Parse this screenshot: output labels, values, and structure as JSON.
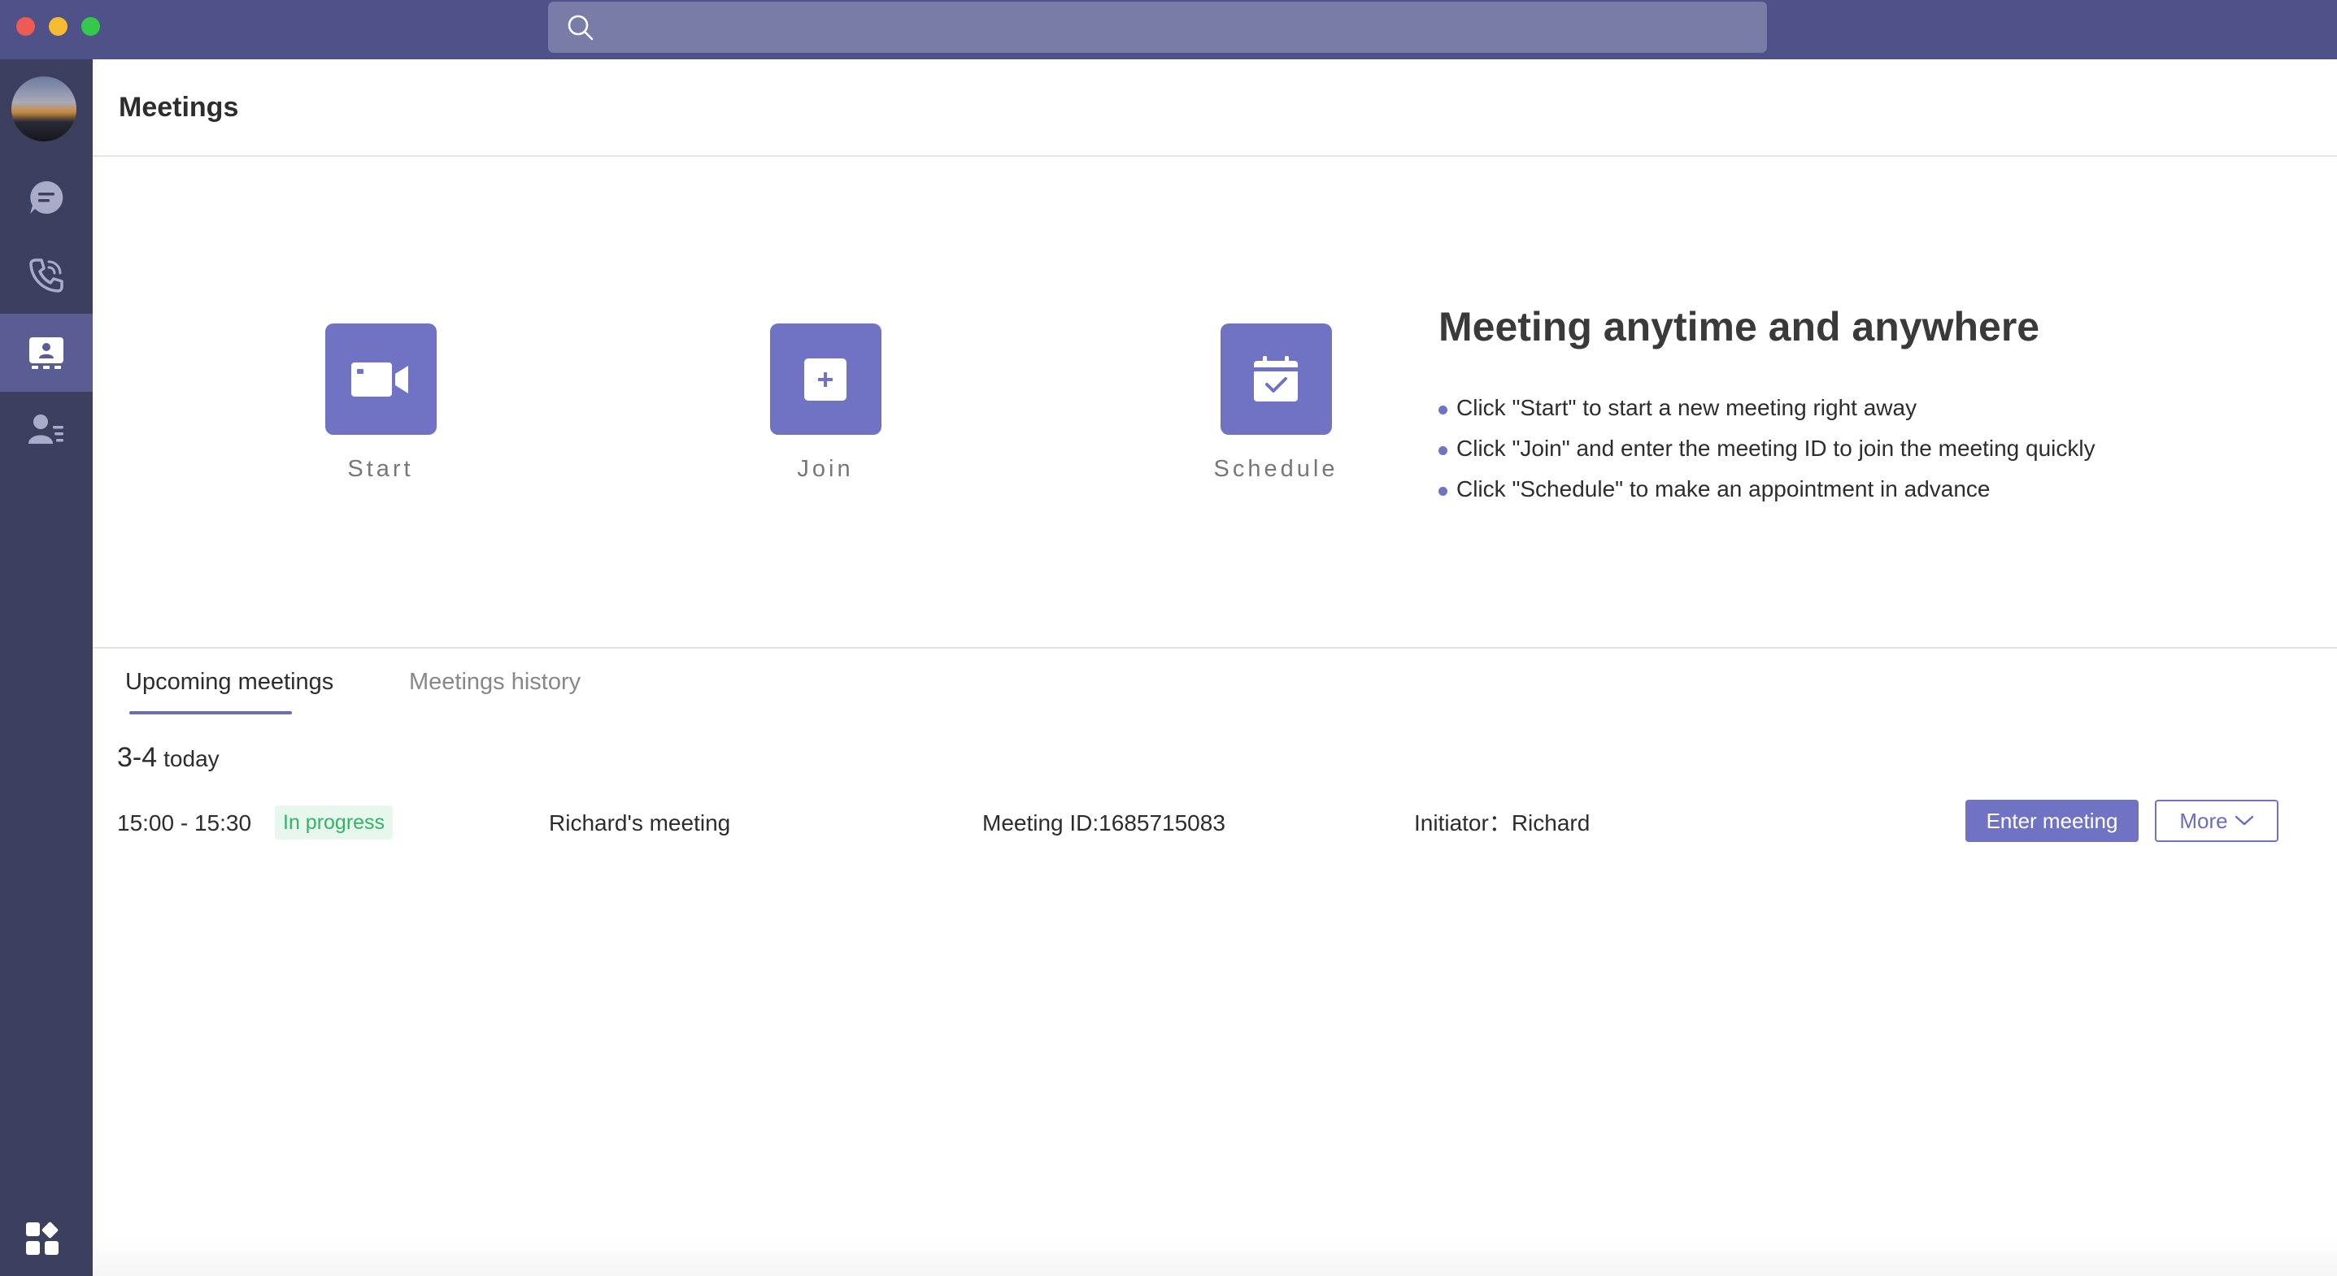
{
  "titlebar": {
    "search_icon": "search-icon",
    "search_placeholder": ""
  },
  "sidebar": {
    "avatar": "avatar",
    "items": [
      {
        "icon": "chat-icon",
        "active": false
      },
      {
        "icon": "phone-icon",
        "active": false
      },
      {
        "icon": "meetings-icon",
        "active": true
      },
      {
        "icon": "contacts-icon",
        "active": false
      }
    ],
    "bottom_icon": "apps-icon"
  },
  "header": {
    "title": "Meetings"
  },
  "actions": [
    {
      "label": "Start",
      "icon": "video-camera-icon"
    },
    {
      "label": "Join",
      "icon": "join-plus-icon"
    },
    {
      "label": "Schedule",
      "icon": "calendar-check-icon"
    }
  ],
  "info": {
    "title": "Meeting anytime and anywhere",
    "bullets": [
      "Click \"Start\" to start a new meeting right away",
      "Click \"Join\" and enter the meeting ID to join the meeting quickly",
      "Click \"Schedule\" to make an appointment in advance"
    ]
  },
  "tabs": [
    {
      "label": "Upcoming meetings",
      "active": true
    },
    {
      "label": "Meetings history",
      "active": false
    }
  ],
  "date_group": {
    "date": "3-4",
    "suffix": "today"
  },
  "meeting": {
    "time": "15:00 - 15:30",
    "status": "In progress",
    "title": "Richard's meeting",
    "meeting_id": "Meeting ID:1685715083",
    "initiator": "Initiator：Richard",
    "enter_label": "Enter meeting",
    "more_label": "More"
  },
  "colors": {
    "titlebar": "#4f5289",
    "sidebar": "#3d3f5e",
    "accent": "#7073c4",
    "status_green": "#32b366"
  }
}
